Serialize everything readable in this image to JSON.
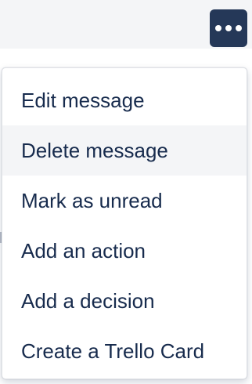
{
  "toolbar": {
    "more_icon": "more-horizontal-icon",
    "more_button_color": "#253858"
  },
  "menu": {
    "items": [
      {
        "label": "Edit message"
      },
      {
        "label": "Delete message",
        "hovered": true
      },
      {
        "label": "Mark as unread"
      },
      {
        "label": "Add an action"
      },
      {
        "label": "Add a decision"
      },
      {
        "label": "Create a Trello Card"
      }
    ]
  },
  "colors": {
    "text": "#172b4d",
    "hover_bg": "#f4f5f7",
    "menu_border": "#dfe1e6"
  }
}
